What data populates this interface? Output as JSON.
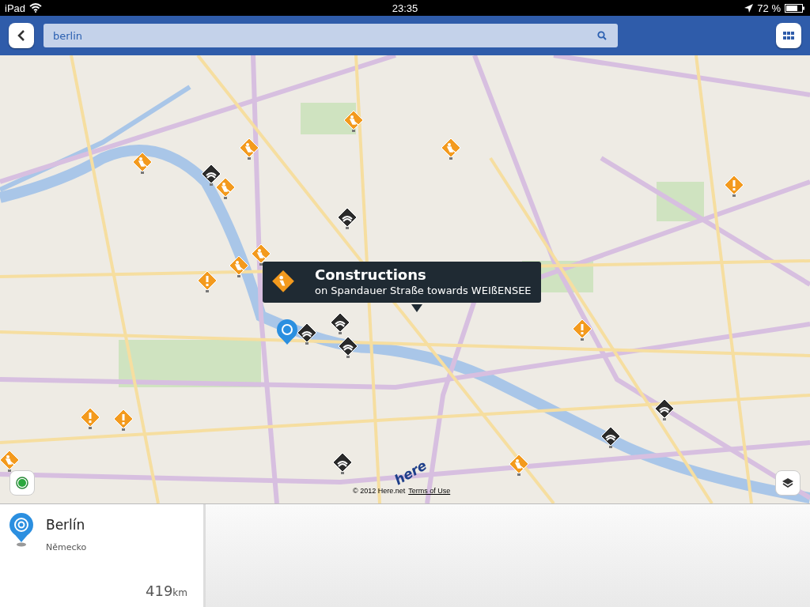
{
  "status_bar": {
    "device": "iPad",
    "time": "23:35",
    "battery": "72 %"
  },
  "search": {
    "value": "berlin"
  },
  "popup": {
    "title": "Constructions",
    "subtitle": "on Spandauer Straße towards WEIßENSEE"
  },
  "map_footer": {
    "logo": "here",
    "copyright": "© 2012 Here.net",
    "terms_link": "Terms of Use"
  },
  "place_card": {
    "name": "Berlín",
    "country": "Německo",
    "distance": "419",
    "unit": "km"
  }
}
